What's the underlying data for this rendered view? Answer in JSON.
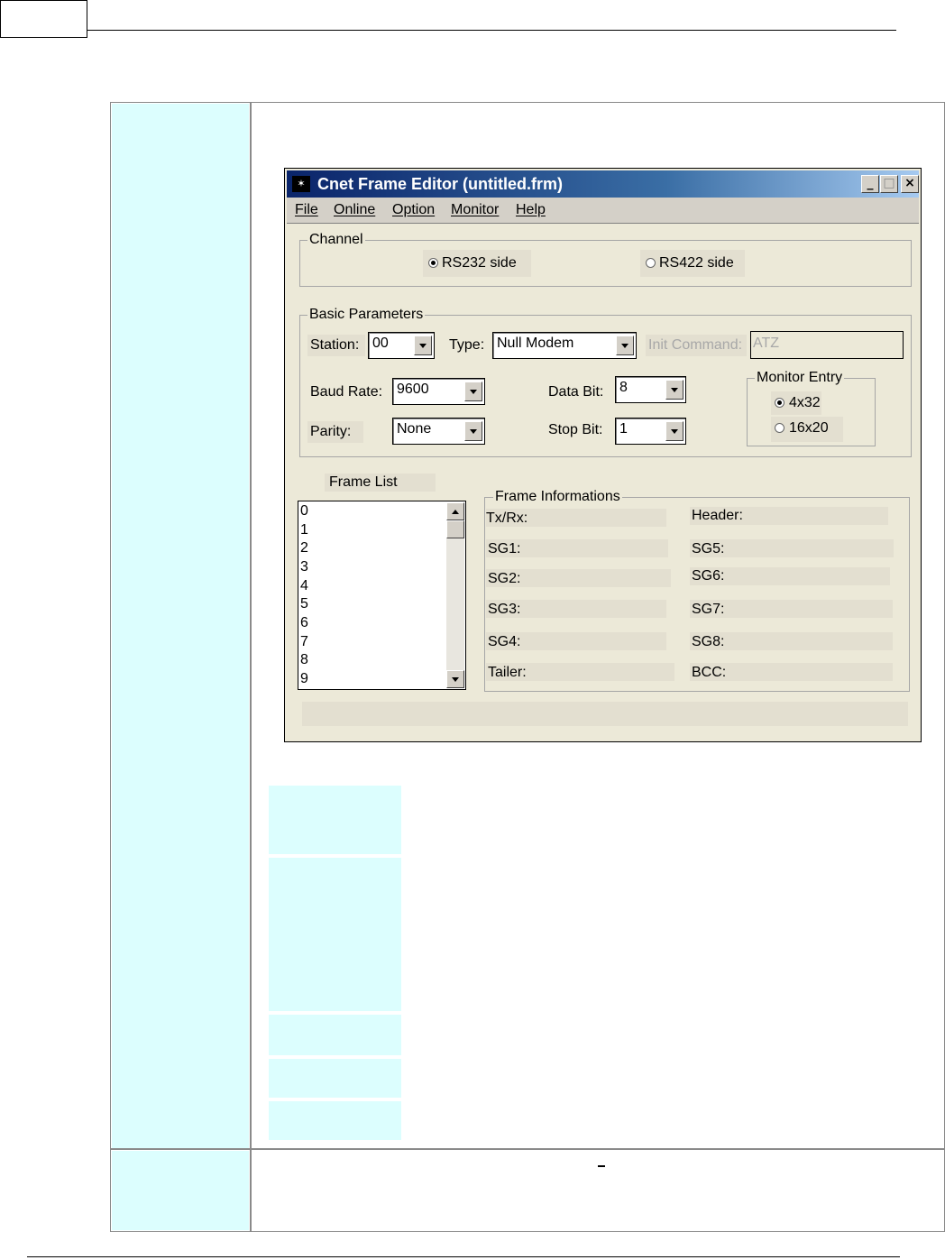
{
  "window": {
    "title": "Cnet Frame Editor (untitled.frm)",
    "icon": "app-icon",
    "controls": {
      "minimize": "_",
      "maximize": "□",
      "close": "×"
    }
  },
  "menu": [
    "File",
    "Online",
    "Option",
    "Monitor",
    "Help"
  ],
  "channel": {
    "legend": "Channel",
    "options": [
      "RS232 side",
      "RS422 side"
    ],
    "selected": "RS232 side"
  },
  "basic": {
    "legend": "Basic Parameters",
    "station_label": "Station:",
    "station_value": "00",
    "type_label": "Type:",
    "type_value": "Null Modem",
    "init_label": "Init Command:",
    "init_value": "ATZ",
    "baud_label": "Baud Rate:",
    "baud_value": "9600",
    "databit_label": "Data Bit:",
    "databit_value": "8",
    "parity_label": "Parity:",
    "parity_value": "None",
    "stopbit_label": "Stop Bit:",
    "stopbit_value": "1",
    "monitor": {
      "legend": "Monitor Entry",
      "options": [
        "4x32",
        "16x20"
      ],
      "selected": "4x32"
    }
  },
  "frame_list": {
    "label": "Frame List",
    "items": [
      "0",
      "1",
      "2",
      "3",
      "4",
      "5",
      "6",
      "7",
      "8",
      "9"
    ]
  },
  "frame_info": {
    "legend": "Frame Informations",
    "left": [
      "Tx/Rx:",
      "SG1:",
      "SG2:",
      "SG3:",
      "SG4:",
      "Tailer:"
    ],
    "right": [
      "Header:",
      "SG5:",
      "SG6:",
      "SG7:",
      "SG8:",
      "BCC:"
    ]
  },
  "colors": {
    "cell_cyan": "#dcfefe",
    "window_bg": "#ece9d8",
    "titlebar": "#0a246a"
  }
}
